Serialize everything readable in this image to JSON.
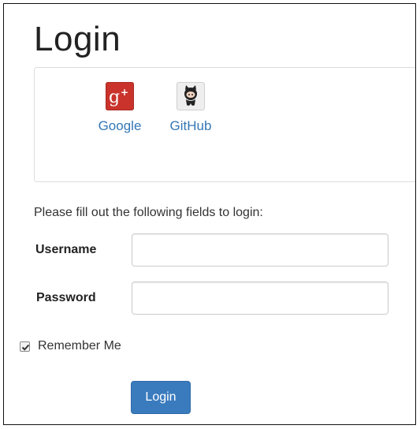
{
  "page": {
    "title": "Login"
  },
  "auth_clients": [
    {
      "name": "Google",
      "icon": "google-plus-icon",
      "color": "#c9332b"
    },
    {
      "name": "GitHub",
      "icon": "github-octocat-icon",
      "color": "#333333"
    }
  ],
  "form": {
    "intro": "Please fill out the following fields to login:",
    "username_label": "Username",
    "username_value": "",
    "password_label": "Password",
    "password_value": "",
    "remember_label": "Remember Me",
    "remember_checked": true,
    "submit_label": "Login"
  },
  "colors": {
    "link": "#3477b6",
    "button": "#3a7bbe"
  }
}
